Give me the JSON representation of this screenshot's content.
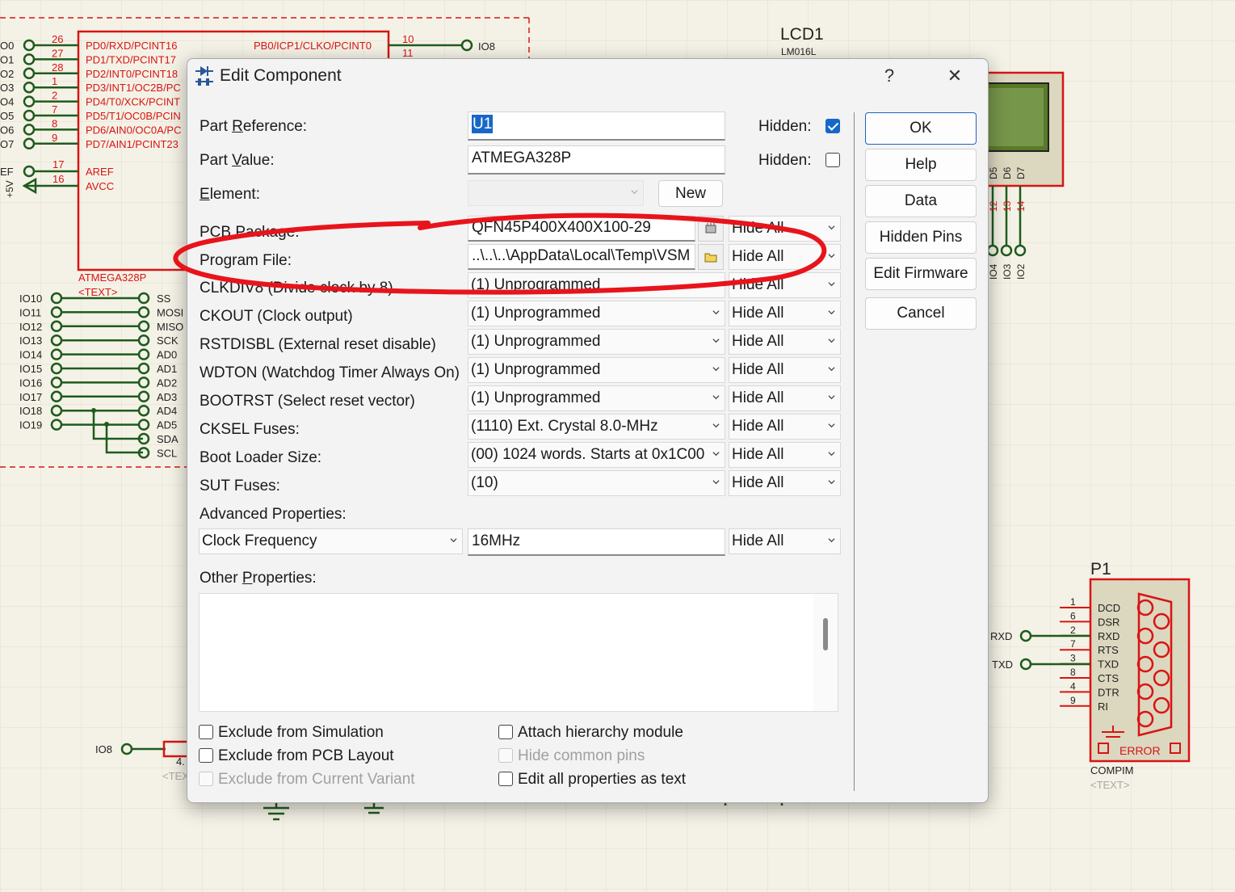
{
  "schematic": {
    "mcu_label": "ATMEGA328P",
    "mcu_text": "<TEXT>",
    "left_pins": [
      {
        "io": "O0",
        "num": "26",
        "name": "PD0/RXD/PCINT16"
      },
      {
        "io": "O1",
        "num": "27",
        "name": "PD1/TXD/PCINT17"
      },
      {
        "io": "O2",
        "num": "28",
        "name": "PD2/INT0/PCINT18"
      },
      {
        "io": "O3",
        "num": "1",
        "name": "PD3/INT1/OC2B/PC"
      },
      {
        "io": "O4",
        "num": "2",
        "name": "PD4/T0/XCK/PCINT"
      },
      {
        "io": "O5",
        "num": "7",
        "name": "PD5/T1/OC0B/PCIN"
      },
      {
        "io": "O6",
        "num": "8",
        "name": "PD6/AIN0/OC0A/PC"
      },
      {
        "io": "O7",
        "num": "9",
        "name": "PD7/AIN1/PCINT23"
      }
    ],
    "aref": {
      "io": "EF",
      "num": "17",
      "name": "AREF"
    },
    "avcc": {
      "num": "16",
      "name": "AVCC",
      "supply": "+5V"
    },
    "right_pin": {
      "num": "10",
      "name": "PB0/ICP1/CLKO/PCINT0",
      "io": "IO8",
      "num2": "11"
    },
    "bus_rows": [
      {
        "io": "IO10",
        "sig": "SS"
      },
      {
        "io": "IO11",
        "sig": "MOSI"
      },
      {
        "io": "IO12",
        "sig": "MISO"
      },
      {
        "io": "IO13",
        "sig": "SCK"
      },
      {
        "io": "IO14",
        "sig": "AD0"
      },
      {
        "io": "IO15",
        "sig": "AD1"
      },
      {
        "io": "IO16",
        "sig": "AD2"
      },
      {
        "io": "IO17",
        "sig": "AD3"
      },
      {
        "io": "IO18",
        "sig": "AD4"
      },
      {
        "io": "IO19",
        "sig": "AD5"
      },
      {
        "io": "",
        "sig": "SDA"
      },
      {
        "io": "",
        "sig": "SCL"
      }
    ],
    "lcd": {
      "ref": "LCD1",
      "part": "LM016L",
      "pins": [
        "D5",
        "D6",
        "D7"
      ],
      "pin_nums": [
        "12",
        "13",
        "14"
      ],
      "io": [
        "IO4",
        "IO3",
        "IO2"
      ]
    },
    "io8_bottom": "IO8",
    "resistor_value": "4.",
    "resistor_text": "<TEX",
    "p1": {
      "ref": "P1",
      "part": "COMPIM",
      "text": "<TEXT>",
      "error": "ERROR",
      "pins": [
        {
          "num": "1",
          "name": "DCD"
        },
        {
          "num": "6",
          "name": "DSR"
        },
        {
          "num": "2",
          "name": "RXD"
        },
        {
          "num": "7",
          "name": "RTS"
        },
        {
          "num": "3",
          "name": "TXD"
        },
        {
          "num": "8",
          "name": "CTS"
        },
        {
          "num": "4",
          "name": "DTR"
        },
        {
          "num": "9",
          "name": "RI"
        }
      ],
      "rxd_label": "RXD",
      "txd_label": "TXD"
    },
    "colors": {
      "wire": "#1e5b1e",
      "part": "#d81414",
      "bg": "#f4f2e6"
    }
  },
  "dialog": {
    "title": "Edit Component",
    "help_glyph": "?",
    "close_glyph": "✕",
    "part_reference": {
      "label_pre": "Part ",
      "label_ul": "R",
      "label_post": "eference:",
      "value": "U1",
      "hidden_label": "Hidden:",
      "hidden_checked": true
    },
    "part_value": {
      "label_pre": "Part ",
      "label_ul": "V",
      "label_post": "alue:",
      "value": "ATMEGA328P",
      "hidden_label": "Hidden:",
      "hidden_checked": false
    },
    "element": {
      "label_pre": "",
      "label_ul": "E",
      "label_post": "lement:",
      "value": "",
      "new_button": "New"
    },
    "pcb_package": {
      "label": "PCB Package:",
      "value": "QFN45P400X400X100-29",
      "visibility": "Hide All"
    },
    "program_file": {
      "label": "Program File:",
      "value": "..\\..\\..\\AppData\\Local\\Temp\\VSM",
      "visibility": "Hide All"
    },
    "properties": [
      {
        "label": "CLKDIV8 (Divide clock by 8)",
        "value": "(1) Unprogrammed",
        "visibility": "Hide All"
      },
      {
        "label": "CKOUT (Clock output)",
        "value": "(1) Unprogrammed",
        "visibility": "Hide All"
      },
      {
        "label": "RSTDISBL (External reset disable)",
        "value": "(1) Unprogrammed",
        "visibility": "Hide All"
      },
      {
        "label": "WDTON (Watchdog Timer Always On)",
        "value": "(1) Unprogrammed",
        "visibility": "Hide All"
      },
      {
        "label": "BOOTRST (Select reset vector)",
        "value": "(1) Unprogrammed",
        "visibility": "Hide All"
      },
      {
        "label": "CKSEL Fuses:",
        "value": "(1110) Ext. Crystal 8.0-MHz",
        "visibility": "Hide All"
      },
      {
        "label": "Boot Loader Size:",
        "value": "(00) 1024 words. Starts at 0x1C00",
        "visibility": "Hide All"
      },
      {
        "label": "SUT Fuses:",
        "value": "(10)",
        "visibility": "Hide All"
      }
    ],
    "advanced": {
      "label": "Advanced Properties:",
      "property": "Clock Frequency",
      "value": "16MHz",
      "visibility": "Hide All"
    },
    "other": {
      "label_pre": "Other ",
      "label_ul": "P",
      "label_post": "roperties:",
      "text": ""
    },
    "checks_left": [
      {
        "label": "Exclude from Simulation",
        "checked": false,
        "disabled": false
      },
      {
        "label": "Exclude from PCB Layout",
        "checked": false,
        "disabled": false
      },
      {
        "label": "Exclude from Current Variant",
        "checked": false,
        "disabled": true
      }
    ],
    "checks_right": [
      {
        "label": "Attach hierarchy module",
        "checked": false,
        "disabled": false
      },
      {
        "label": "Hide common pins",
        "checked": false,
        "disabled": true
      },
      {
        "label": "Edit all properties as text",
        "checked": false,
        "disabled": false
      }
    ],
    "buttons": {
      "ok": "OK",
      "help": "Help",
      "data": "Data",
      "hidden_pins": "Hidden Pins",
      "edit_firmware": "Edit Firmware",
      "cancel": "Cancel"
    },
    "annotation_color": "#e8141c"
  }
}
